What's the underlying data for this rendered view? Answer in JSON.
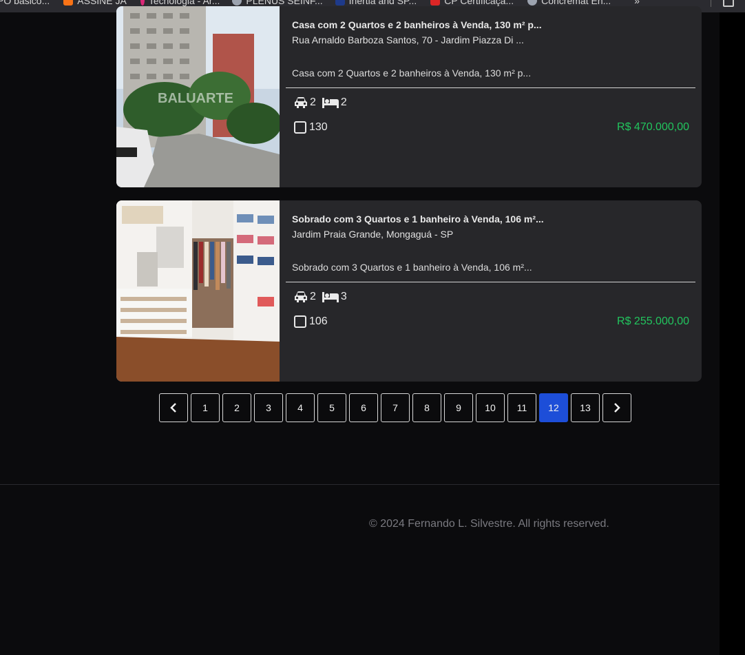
{
  "bookmarks": [
    {
      "label": "PO básico...",
      "color": "#6b7280"
    },
    {
      "label": "ASSINE JÁ",
      "color": "#f97316"
    },
    {
      "label": "Tecnologia - Ar...",
      "color": "#db2777"
    },
    {
      "label": "PLENUS SEINF...",
      "color": "#9ca3af"
    },
    {
      "label": "Inertia and SP...",
      "color": "#1e3a8a"
    },
    {
      "label": "CP Certificaçã...",
      "color": "#dc2626"
    },
    {
      "label": "Concremat En...",
      "color": "#9ca3af"
    }
  ],
  "bookmarks_more": "»",
  "listings": [
    {
      "title": "Casa com 2 Quartos e 2 banheiros à Venda, 130 m² p...",
      "address": "Rua Arnaldo Barboza Santos, 70 - Jardim Piazza Di ...",
      "description": "Casa com 2 Quartos e 2 banheiros à Venda, 130 m² p...",
      "parking": "2",
      "bedrooms": "2",
      "area": "130",
      "price": "R$ 470.000,00",
      "watermark": "BALUARTE"
    },
    {
      "title": "Sobrado com 3 Quartos e 1 banheiro à Venda, 106 m²...",
      "address": "Jardim Praia Grande, Mongaguá - SP",
      "description": "Sobrado com 3 Quartos e 1 banheiro à Venda, 106 m²...",
      "parking": "2",
      "bedrooms": "3",
      "area": "106",
      "price": "R$ 255.000,00"
    }
  ],
  "pagination": {
    "pages": [
      "1",
      "2",
      "3",
      "4",
      "5",
      "6",
      "7",
      "8",
      "9",
      "10",
      "11",
      "12",
      "13"
    ],
    "current": "12",
    "active_color": "#1d4ed8"
  },
  "footer": {
    "copyright": "© 2024 Fernando L. Silvestre. All rights reserved."
  },
  "colors": {
    "background": "#0b0b0d",
    "card": "#27272a",
    "price": "#22c55e"
  }
}
